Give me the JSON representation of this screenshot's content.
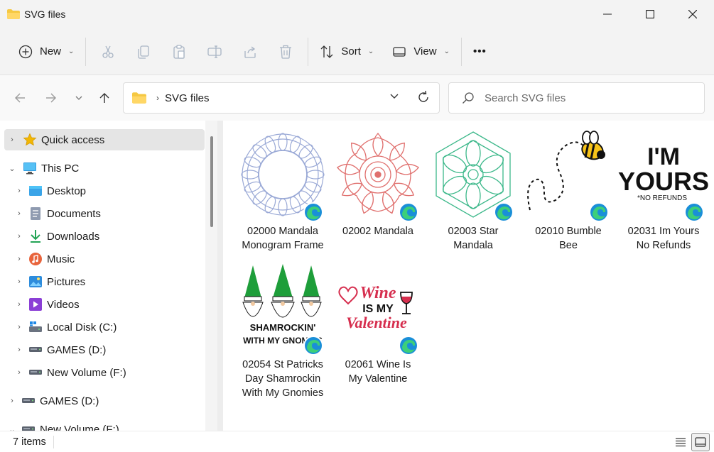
{
  "window": {
    "title": "SVG files"
  },
  "commandbar": {
    "new_label": "New",
    "sort_label": "Sort",
    "view_label": "View",
    "more_label": "•••"
  },
  "address": {
    "crumb": "SVG files",
    "search_placeholder": "Search SVG files"
  },
  "sidebar": {
    "items": [
      {
        "label": "Quick access",
        "icon": "star-icon"
      },
      {
        "label": "This PC",
        "icon": "monitor-icon"
      },
      {
        "label": "Desktop",
        "icon": "desktop-icon"
      },
      {
        "label": "Documents",
        "icon": "documents-icon"
      },
      {
        "label": "Downloads",
        "icon": "download-icon"
      },
      {
        "label": "Music",
        "icon": "music-icon"
      },
      {
        "label": "Pictures",
        "icon": "pictures-icon"
      },
      {
        "label": "Videos",
        "icon": "videos-icon"
      },
      {
        "label": "Local Disk (C:)",
        "icon": "disk-icon"
      },
      {
        "label": "GAMES (D:)",
        "icon": "drive-icon"
      },
      {
        "label": "New Volume (F:)",
        "icon": "drive-icon"
      },
      {
        "label": "GAMES (D:)",
        "icon": "drive-icon"
      },
      {
        "label": "New Volume (F:)",
        "icon": "drive-icon"
      }
    ]
  },
  "files": [
    {
      "name": "02000 Mandala Monogram Frame"
    },
    {
      "name": "02002 Mandala"
    },
    {
      "name": "02003 Star Mandala"
    },
    {
      "name": "02010 Bumble Bee"
    },
    {
      "name": "02031 Im Yours No Refunds",
      "art_text_1": "I'M",
      "art_text_2": "YOURS",
      "art_text_3": "*NO REFUNDS"
    },
    {
      "name": "02054 St Patricks Day Shamrockin With My Gnomies",
      "art_text_1": "SHAMROCKIN'",
      "art_text_2": "WITH MY GNOMIES"
    },
    {
      "name": "02061 Wine Is My Valentine",
      "art_text_1": "Wine",
      "art_text_2": "IS MY",
      "art_text_3": "Valentine"
    }
  ],
  "status": {
    "count": "7 items"
  },
  "colors": {
    "mandala1": "#9aa9d6",
    "mandala2": "#e0706e",
    "mandala3": "#3cb88a",
    "accent": "#0067c0",
    "folder": "#f5c842",
    "gnome_green": "#1e9e3a",
    "wine_red": "#d62e4e"
  }
}
